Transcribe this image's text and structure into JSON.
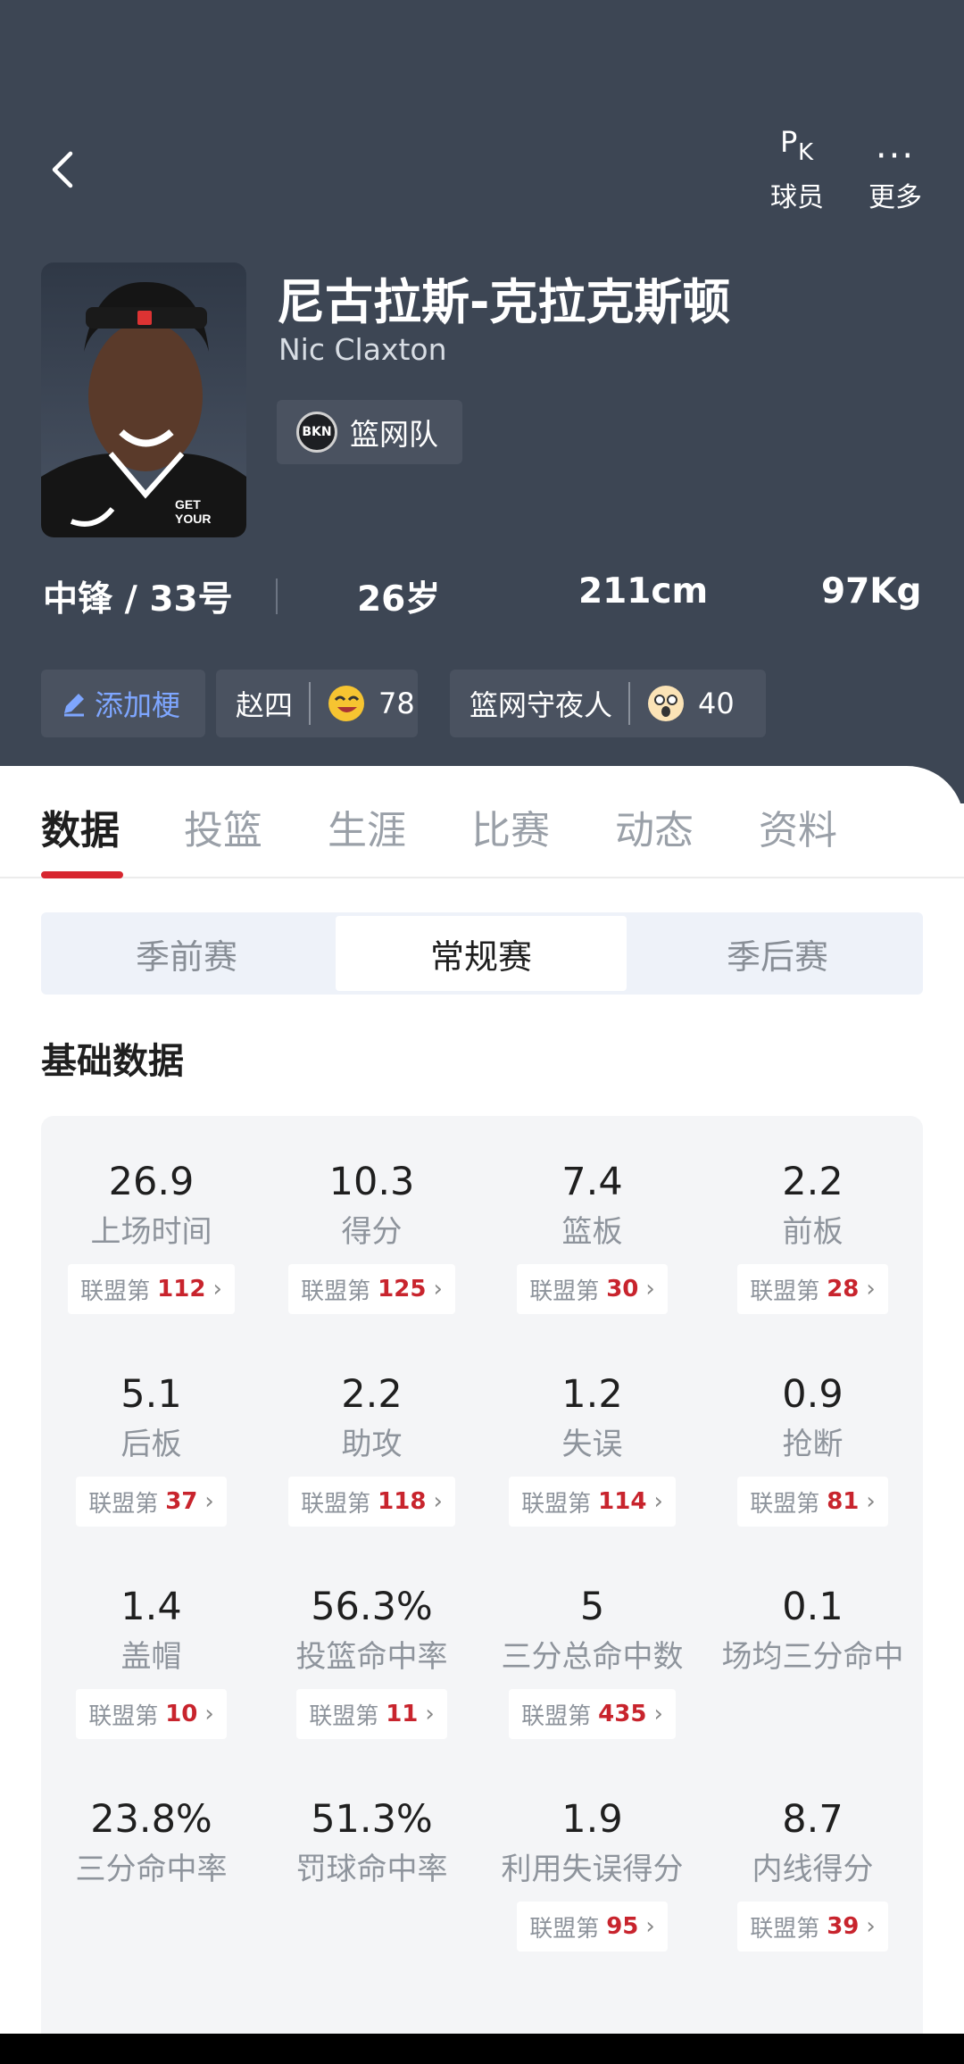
{
  "header": {
    "actions": [
      {
        "icon": "pk-icon",
        "label": "球员"
      },
      {
        "icon": "more-icon",
        "label": "更多"
      }
    ],
    "player": {
      "name_cn": "尼古拉斯-克拉克斯顿",
      "name_en": "Nic Claxton",
      "team": "篮网队",
      "team_logo_text": "BKN"
    },
    "info": {
      "position_number": "中锋 / 33号",
      "age": "26岁",
      "height": "211cm",
      "weight": "97Kg"
    },
    "tags": {
      "add_label": "添加梗",
      "items": [
        {
          "text": "赵四",
          "count": "78"
        },
        {
          "text": "篮网守夜人",
          "count": "40"
        }
      ]
    }
  },
  "tabs": [
    "数据",
    "投篮",
    "生涯",
    "比赛",
    "动态",
    "资料"
  ],
  "season_types": [
    "季前赛",
    "常规赛",
    "季后赛"
  ],
  "section_title": "基础数据",
  "rank_prefix": "联盟第",
  "stats": [
    {
      "value": "26.9",
      "label": "上场时间",
      "rank": "112"
    },
    {
      "value": "10.3",
      "label": "得分",
      "rank": "125"
    },
    {
      "value": "7.4",
      "label": "篮板",
      "rank": "30"
    },
    {
      "value": "2.2",
      "label": "前板",
      "rank": "28"
    },
    {
      "value": "5.1",
      "label": "后板",
      "rank": "37"
    },
    {
      "value": "2.2",
      "label": "助攻",
      "rank": "118"
    },
    {
      "value": "1.2",
      "label": "失误",
      "rank": "114"
    },
    {
      "value": "0.9",
      "label": "抢断",
      "rank": "81"
    },
    {
      "value": "1.4",
      "label": "盖帽",
      "rank": "10"
    },
    {
      "value": "56.3%",
      "label": "投篮命中率",
      "rank": "11"
    },
    {
      "value": "5",
      "label": "三分总命中数",
      "rank": "435"
    },
    {
      "value": "0.1",
      "label": "场均三分命中",
      "rank": ""
    },
    {
      "value": "23.8%",
      "label": "三分命中率",
      "rank": ""
    },
    {
      "value": "51.3%",
      "label": "罚球命中率",
      "rank": ""
    },
    {
      "value": "1.9",
      "label": "利用失误得分",
      "rank": "95"
    },
    {
      "value": "8.7",
      "label": "内线得分",
      "rank": "39"
    }
  ],
  "colors": {
    "header_bg": "#3d4654",
    "accent_red": "#d7262f",
    "rank_red": "#c8242d"
  }
}
